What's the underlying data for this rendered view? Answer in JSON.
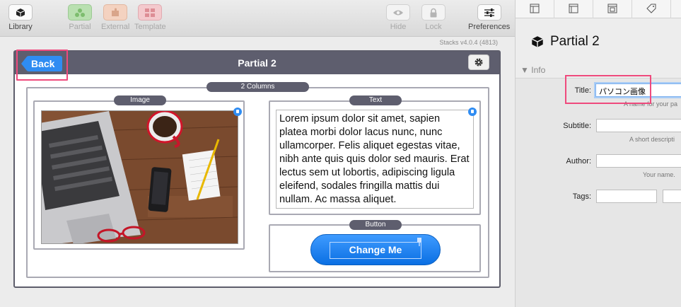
{
  "toolbar": {
    "library": "Library",
    "partial": "Partial",
    "external": "External",
    "template": "Template",
    "hide": "Hide",
    "lock": "Lock",
    "preferences": "Preferences"
  },
  "version": "Stacks v4.0.4 (4813)",
  "editor": {
    "back_label": "Back",
    "title": "Partial 2",
    "columns_label": "2 Columns",
    "image_label": "Image",
    "text_label": "Text",
    "button_label": "Button",
    "body_text": "Lorem ipsum dolor sit amet, sapien platea morbi dolor lacus nunc, nunc ullamcorper. Felis aliquet egestas vitae, nibh ante quis quis dolor sed mauris. Erat lectus sem ut lobortis, adipiscing ligula eleifend, sodales fringilla mattis dui nullam. Ac massa aliquet.",
    "change_button": "Change Me"
  },
  "inspector": {
    "title": "Partial 2",
    "section": "Info",
    "fields": {
      "title_label": "Title:",
      "title_value": "パソコン画像",
      "title_hint": "A name for your pa",
      "subtitle_label": "Subtitle:",
      "subtitle_hint": "A short descripti",
      "author_label": "Author:",
      "author_hint": "Your name.",
      "tags_label": "Tags:"
    }
  },
  "colors": {
    "accent_blue": "#2f8cf2",
    "header_gray": "#5e5e6e",
    "highlight_pink": "#ef4a7d"
  }
}
